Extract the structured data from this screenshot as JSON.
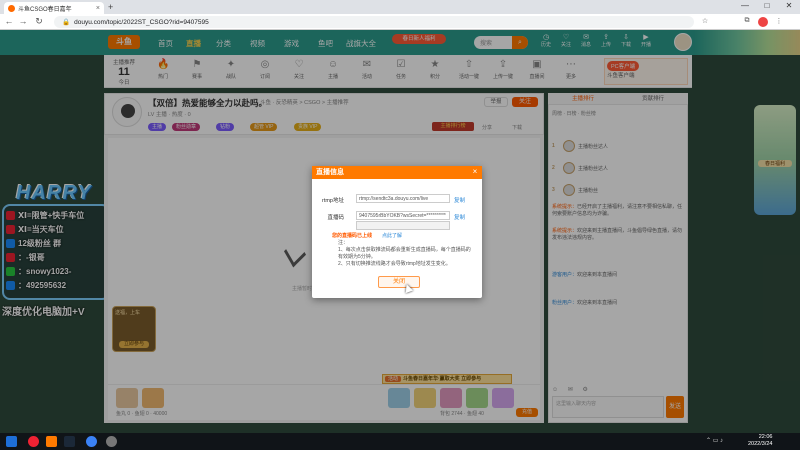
{
  "browser": {
    "tab_title": "斗鱼CSGO春日嘉年",
    "tab_close": "×",
    "new_tab": "+",
    "url": "douyu.com/topic/2022ST_CSGO?rid=9407595",
    "back": "←",
    "forward": "→",
    "reload": "↻",
    "minimize": "—",
    "maximize": "□",
    "close": "✕"
  },
  "site_header": {
    "logo": "斗鱼",
    "nav": [
      "首页",
      "直播",
      "分类",
      "视频",
      "游戏",
      "鱼吧",
      "战旗大全"
    ],
    "promo": "春日新人福利",
    "search_placeholder": "搜索",
    "icons": [
      {
        "name": "history-icon",
        "label": "历史"
      },
      {
        "name": "follow-icon",
        "label": "关注"
      },
      {
        "name": "message-icon",
        "label": "消息"
      },
      {
        "name": "upload-icon",
        "label": "上传"
      },
      {
        "name": "download-icon",
        "label": "下载"
      },
      {
        "name": "live-icon",
        "label": "开播"
      }
    ]
  },
  "category_bar": {
    "date_top": "主播推荐",
    "date_num": "11",
    "date_bottom": "今日",
    "items": [
      "热门",
      "赛事",
      "战队",
      "订阅",
      "关注",
      "主播",
      "活动",
      "任务",
      "积分",
      "活动一键",
      "上传一键",
      "直播间",
      "更多"
    ],
    "right_pill": "PC客户端",
    "right_text": "斗鱼客户端"
  },
  "overlay": {
    "brand": "HARRY",
    "lines": [
      {
        "color": "#e23",
        "text": "Ⅺ=限管+快手车位"
      },
      {
        "color": "#e23",
        "text": "Ⅺ=当天车位"
      },
      {
        "color": "#1a8cff",
        "text": "12级粉丝 群"
      },
      {
        "color": "#e23",
        "text": "：-银哥"
      },
      {
        "color": "#28c840",
        "text": "：snowy1023-"
      },
      {
        "color": "#1a8cff",
        "text": "：492595632"
      }
    ],
    "slogan": "深度优化电脑加+V"
  },
  "stream": {
    "title": "【双倍】热爱能够全力以赴吗。",
    "meta": "斗鱼 · 反恐精英 > CSGO > 主播推荐",
    "sub": "LV 主播 · 热度 · 0",
    "tags": [
      {
        "text": "主播",
        "color": "#7c5cff"
      },
      {
        "text": "粉丝勋章",
        "color": "#c03a7a"
      },
      {
        "text": "钻粉",
        "color": "#7c5cff"
      },
      {
        "text": "超管 VIP",
        "color": "#e69a1a"
      },
      {
        "text": "贵族 VIP",
        "color": "#e6b01a"
      }
    ],
    "report": "举报",
    "follow": "关注",
    "rank_badge": "主播排行榜",
    "small_actions": [
      "分享",
      "下载"
    ],
    "video_hint": "主播暂时离开...",
    "gift_card_title": "送福，上车",
    "gift_card_btn": "立即参与"
  },
  "bottom": {
    "banner_tag": "活动",
    "banner_text": "斗鱼春日嘉年华·赢取大奖 立即参与",
    "left_text": "鱼丸 0 · 鱼翅 0 · 40000",
    "right_text": "背包 2744 · 鱼翅 40",
    "charge": "充值"
  },
  "right_panel": {
    "tabs": [
      "主播排行",
      "贡献排行"
    ],
    "sub": "周榜 · 日榜 · 粉丝榜",
    "ranks": [
      {
        "num": "1",
        "text": "主播粉丝达人"
      },
      {
        "num": "2",
        "text": "主播粉丝达人"
      },
      {
        "num": "3",
        "text": "主播粉丝"
      }
    ],
    "chat": [
      {
        "sys": "系统提示：",
        "nm": "",
        "text": "已经开启了主播福利，请注意不要相信私聊，任何索要账户信息均为诈骗。"
      },
      {
        "sys": "系统提示：",
        "nm": "",
        "text": "欢迎来到主播直播间，斗鱼倡导绿色直播，请勿发布违法违规内容。"
      },
      {
        "sys": "",
        "nm": "游客用户：",
        "text": "欢迎来到本直播间"
      },
      {
        "sys": "",
        "nm": "粉丝用户：",
        "text": "欢迎来到本直播间"
      }
    ],
    "input_placeholder": "这里输入聊天内容",
    "send": "发送",
    "icons": "☺ ✉ ⚙"
  },
  "float_widget": {
    "text": "春日福利"
  },
  "dialog": {
    "title": "直播信息",
    "close": "×",
    "rtmp_label": "rtmp地址",
    "rtmp_value": "rtmp://sendtc3a.douyu.com/live",
    "key_label": "直播码",
    "key_value": "9407595rBbYOKB?wsSecret=**********",
    "copy": "复制",
    "warn": "您的直播码已上线",
    "warn_link": "点此了解",
    "notes_title": "注：",
    "notes": [
      "1、每次点击获取推流码都会重新生成直播码，每个直播码的有效期为5分钟。",
      "2、只有切换推流线路才会导致rtmp地址发生变化。"
    ],
    "ok": "关闭"
  },
  "taskbar": {
    "time": "22:06",
    "date": "2022/3/24"
  }
}
